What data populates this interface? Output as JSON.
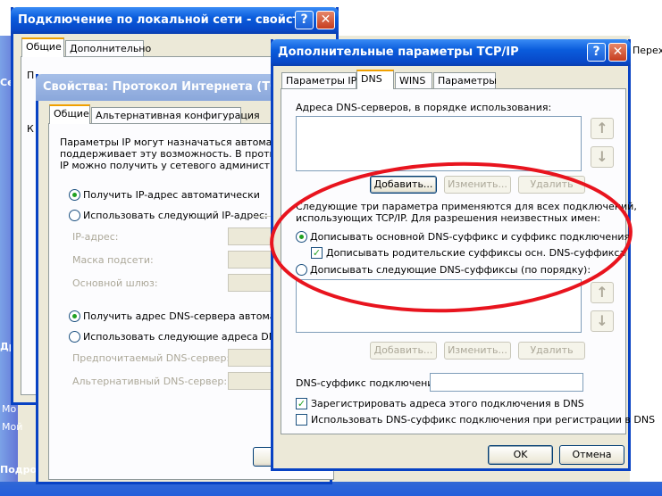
{
  "background": {
    "right_edge_text": "Перех",
    "left_labels": [
      "Се",
      "Др",
      "Мо",
      "Мой",
      "Подроб"
    ]
  },
  "win_connection": {
    "title": "Подключение по локальной сети - свойства",
    "tabs": [
      "Общие",
      "Дополнительно"
    ],
    "fragment_p": "П",
    "fragment_k": "К"
  },
  "win_tcpip": {
    "title": "Свойства: Протокол Интернета (TCP/IP)",
    "tabs": [
      "Общие",
      "Альтернативная конфигурация"
    ],
    "desc": [
      "Параметры IP могут назначаться автоматически,",
      "поддерживает эту возможность. В противном",
      "IP можно получить у сетевого администратора."
    ],
    "radio_ip_auto": "Получить IP-адрес автоматически",
    "radio_ip_manual": "Использовать следующий IP-адрес:",
    "ip_label": "IP-адрес:",
    "mask_label": "Маска подсети:",
    "gateway_label": "Основной шлюз:",
    "radio_dns_auto": "Получить адрес DNS-сервера автоматически",
    "radio_dns_manual": "Использовать следующие адреса DNS-сервер",
    "preferred_dns": "Предпочитаемый DNS-сервер:",
    "alternate_dns": "Альтернативный DNS-сервер:"
  },
  "win_advanced": {
    "title": "Дополнительные параметры TCP/IP",
    "tabs": [
      "Параметры IP",
      "DNS",
      "WINS",
      "Параметры"
    ],
    "dns_list_label": "Адреса DNS-серверов, в порядке использования:",
    "add_button": "Добавить...",
    "edit_button": "Изменить...",
    "delete_button": "Удалить",
    "suffix_desc_1": "Следующие три параметра применяются для всех подключений,",
    "suffix_desc_2": "использующих TCP/IP. Для разрешения неизвестных имен:",
    "radio_append_primary": "Дописывать основной DNS-суффикс и суффикс подключения",
    "check_append_parent": "Дописывать родительские суффиксы осн. DNS-суффикса",
    "radio_append_these": "Дописывать следующие DNS-суффиксы (по порядку):",
    "add_button_2": "Добавить...",
    "edit_button_2": "Изменить...",
    "delete_button_2": "Удалить",
    "connection_suffix_label": "DNS-суффикс подключения:",
    "connection_suffix_value": "",
    "check_register": "Зарегистрировать адреса этого подключения в DNS",
    "check_use_suffix": "Использовать DNS-суффикс подключения при регистрации в DNS",
    "ok_button": "OK",
    "cancel_button": "Отмена",
    "help_glyph": "?",
    "close_glyph": "✕",
    "up_glyph": "↑",
    "down_glyph": "↓"
  },
  "annotation": {
    "shape": "red ellipse",
    "color": "#e8141e"
  }
}
